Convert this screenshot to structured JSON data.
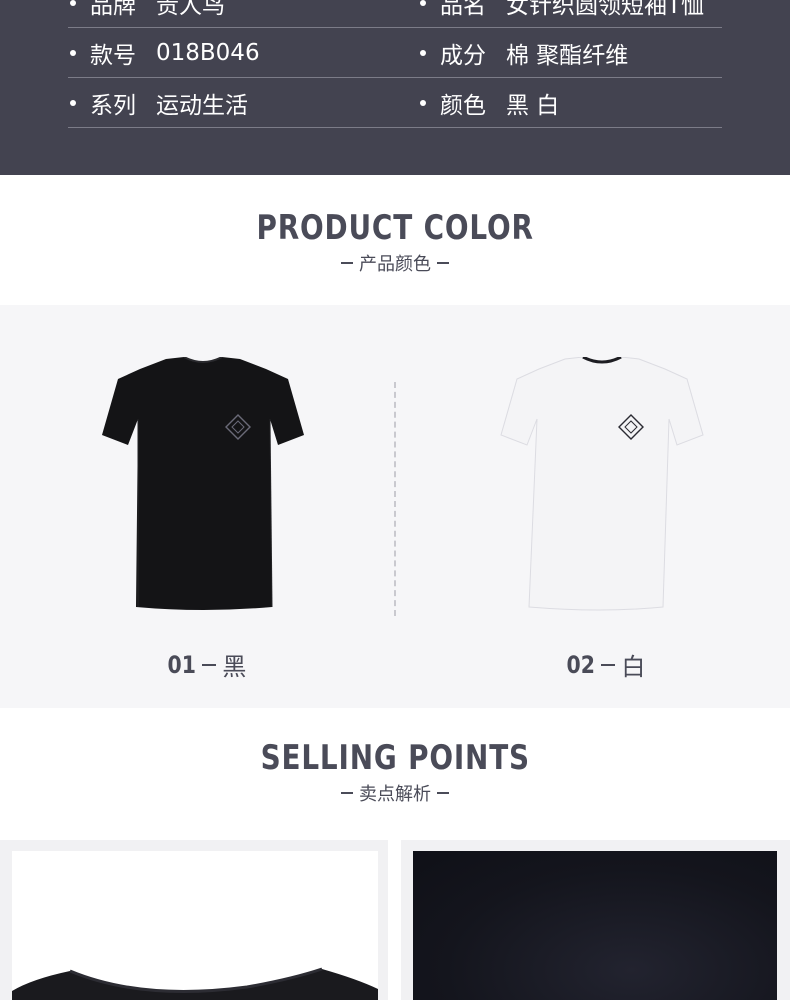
{
  "specs": {
    "rows": [
      {
        "left": {
          "key": "品牌",
          "value": "贵人鸟"
        },
        "right": {
          "key": "品名",
          "value": "女针织圆领短袖T恤"
        }
      },
      {
        "left": {
          "key": "款号",
          "value": "018B046"
        },
        "right": {
          "key": "成分",
          "value": "棉 聚酯纤维"
        }
      },
      {
        "left": {
          "key": "系列",
          "value": "运动生活"
        },
        "right": {
          "key": "颜色",
          "value": "黑 白"
        }
      }
    ]
  },
  "product_color": {
    "title_en": "PRODUCT COLOR",
    "title_zh": "产品颜色",
    "items": [
      {
        "number": "01",
        "color_name": "黑",
        "shirt_color": "#141416"
      },
      {
        "number": "02",
        "color_name": "白",
        "shirt_color": "#f4f4f6"
      }
    ]
  },
  "selling_points": {
    "title_en": "SELLING POINTS",
    "title_zh": "卖点解析"
  },
  "colors": {
    "spec_background": "#434350",
    "heading_text": "#4a4b58",
    "color_panel_background": "#f6f6f8"
  }
}
